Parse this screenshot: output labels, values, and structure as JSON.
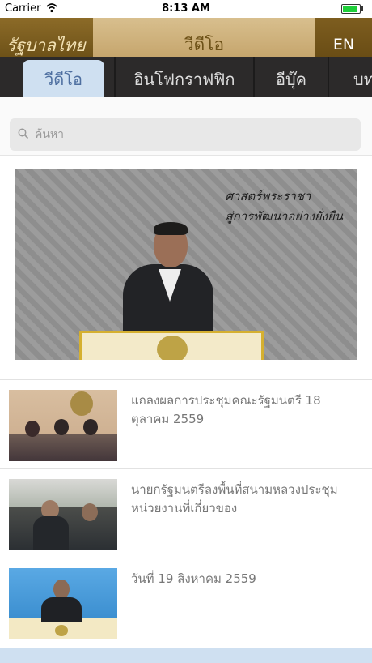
{
  "status_bar": {
    "carrier": "Carrier",
    "time": "8:13 AM"
  },
  "header": {
    "logo": "รัฐบาลไทย",
    "title": "วีดีโอ",
    "lang_button": "EN"
  },
  "tabs": [
    {
      "label": "วีดีโอ"
    },
    {
      "label": "อินโฟกราฟฟิก"
    },
    {
      "label": "อีบุ๊ค"
    },
    {
      "label": "บท"
    }
  ],
  "search": {
    "placeholder": "ค้นหา"
  },
  "featured": {
    "caption_line1": "ศาสตร์พระราชา",
    "caption_line2": "สู่การพัฒนาอย่างยั่งยืน"
  },
  "videos": [
    {
      "title": "แถลงผลการประชุมคณะรัฐมนตรี 18 ตุลาคม 2559"
    },
    {
      "title": "นายกรัฐมนตรีลงพื้นที่สนามหลวงประชุมหน่วยงานที่เกี่ยวของ"
    },
    {
      "title": "วันที่ 19 สิงหาคม 2559"
    }
  ],
  "colors": {
    "header_gold": "#8a6a2a",
    "tab_bar": "#2c2a2a",
    "active_tab": "#cfe0f1"
  }
}
